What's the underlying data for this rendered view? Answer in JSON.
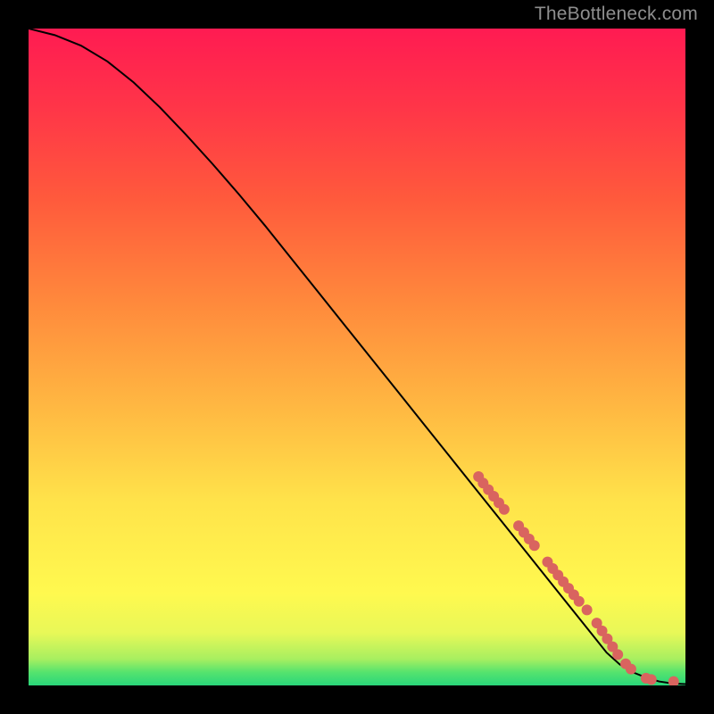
{
  "watermark": "TheBottleneck.com",
  "chart_data": {
    "type": "line",
    "title": "",
    "xlabel": "",
    "ylabel": "",
    "xlim": [
      0,
      100
    ],
    "ylim": [
      0,
      100
    ],
    "background_gradient": {
      "stops": [
        {
          "y": 0,
          "color": "#29d67a"
        },
        {
          "y": 2,
          "color": "#55e36e"
        },
        {
          "y": 4,
          "color": "#a7ef60"
        },
        {
          "y": 8,
          "color": "#e8f858"
        },
        {
          "y": 14,
          "color": "#fff94f"
        },
        {
          "y": 28,
          "color": "#ffe34a"
        },
        {
          "y": 42,
          "color": "#ffb942"
        },
        {
          "y": 58,
          "color": "#ff8a3c"
        },
        {
          "y": 74,
          "color": "#ff5a3c"
        },
        {
          "y": 88,
          "color": "#ff3548"
        },
        {
          "y": 100,
          "color": "#ff1b52"
        }
      ]
    },
    "series": [
      {
        "name": "curve",
        "kind": "line",
        "color": "#000000",
        "x": [
          0,
          4,
          8,
          12,
          16,
          20,
          24,
          28,
          32,
          36,
          40,
          44,
          48,
          52,
          56,
          60,
          64,
          68,
          72,
          76,
          80,
          84,
          86,
          88,
          90,
          92,
          94,
          96,
          98,
          100
        ],
        "y": [
          100,
          99.0,
          97.4,
          95.0,
          91.8,
          88.0,
          83.8,
          79.4,
          74.8,
          70.0,
          65.0,
          60.0,
          55.0,
          50.0,
          45.0,
          40.0,
          35.0,
          30.0,
          25.0,
          20.0,
          15.0,
          10.0,
          7.5,
          5.0,
          3.2,
          2.0,
          1.2,
          0.6,
          0.3,
          0.2
        ]
      },
      {
        "name": "points",
        "kind": "scatter",
        "color": "#d9645f",
        "radius": 6,
        "x": [
          68.5,
          69.2,
          70.0,
          70.8,
          71.6,
          72.4,
          74.6,
          75.4,
          76.2,
          77.0,
          79.0,
          79.8,
          80.6,
          81.4,
          82.2,
          83.0,
          83.8,
          85.0,
          86.5,
          87.3,
          88.1,
          88.9,
          89.7,
          90.9,
          91.7,
          94.0,
          94.8,
          98.2
        ],
        "y": [
          31.8,
          30.8,
          29.8,
          28.8,
          27.8,
          26.8,
          24.3,
          23.3,
          22.3,
          21.3,
          18.8,
          17.8,
          16.8,
          15.8,
          14.8,
          13.8,
          12.8,
          11.5,
          9.5,
          8.3,
          7.1,
          5.9,
          4.7,
          3.3,
          2.5,
          1.1,
          0.9,
          0.6
        ]
      }
    ]
  }
}
